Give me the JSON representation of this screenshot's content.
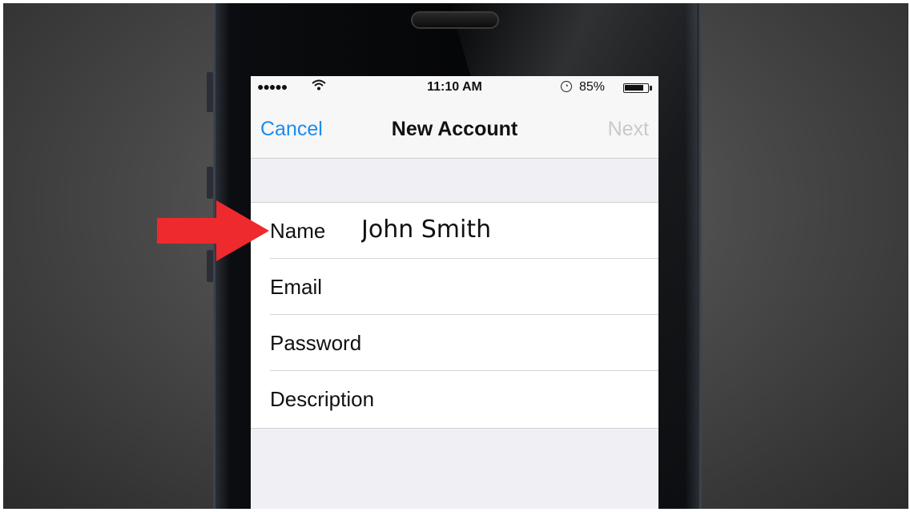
{
  "status_bar": {
    "signal": "●●●●●",
    "wifi_icon": "wifi-icon",
    "time": "11:10 AM",
    "lock_icon": "rotation-lock-icon",
    "battery_percent": "85%",
    "battery_level": 0.85
  },
  "nav_bar": {
    "cancel_label": "Cancel",
    "title": "New Account",
    "next_label": "Next"
  },
  "form": {
    "fields": [
      {
        "label": "Name",
        "value": "John Smith"
      },
      {
        "label": "Email",
        "value": ""
      },
      {
        "label": "Password",
        "value": ""
      },
      {
        "label": "Description",
        "value": ""
      }
    ]
  },
  "colors": {
    "accent": "#1a8cf0",
    "arrow": "#ee2a2f",
    "disabled": "#c9c9ce"
  }
}
